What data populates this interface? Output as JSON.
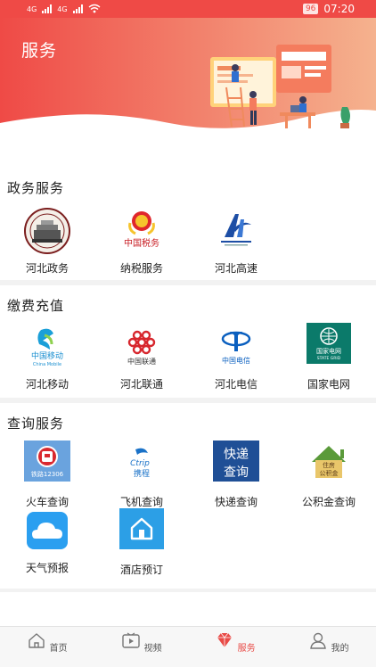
{
  "status_bar": {
    "signal_1": "4G",
    "signal_2": "4G",
    "battery": "96",
    "time": "07:20"
  },
  "header": {
    "title": "服务"
  },
  "sections": [
    {
      "title": "政务服务",
      "items": [
        {
          "label": "河北政务",
          "icon": "hebei-government-emblem-icon"
        },
        {
          "label": "纳税服务",
          "icon": "china-tax-emblem-icon"
        },
        {
          "label": "河北高速",
          "icon": "hebei-expressway-logo-icon"
        }
      ]
    },
    {
      "title": "缴费充值",
      "items": [
        {
          "label": "河北移动",
          "icon": "china-mobile-logo-icon",
          "logo_text": "中国移动",
          "logo_sub": "China Mobile"
        },
        {
          "label": "河北联通",
          "icon": "china-unicom-logo-icon",
          "logo_text": "中国联通"
        },
        {
          "label": "河北电信",
          "icon": "china-telecom-logo-icon",
          "logo_text": "中国电信"
        },
        {
          "label": "国家电网",
          "icon": "state-grid-logo-icon",
          "logo_text": "国家电网",
          "logo_sub": "STATE GRID"
        }
      ]
    },
    {
      "title": "查询服务",
      "items": [
        {
          "label": "火车查询",
          "icon": "railway-12306-icon",
          "logo_text": "铁路12306"
        },
        {
          "label": "飞机查询",
          "icon": "ctrip-logo-icon",
          "logo_text": "携程",
          "logo_sub": "Ctrip"
        },
        {
          "label": "快递查询",
          "icon": "express-query-icon",
          "logo_text_1": "快递",
          "logo_text_2": "查询"
        },
        {
          "label": "公积金查询",
          "icon": "housing-fund-icon",
          "logo_text_1": "住房",
          "logo_text_2": "公积金"
        },
        {
          "label": "天气预报",
          "icon": "weather-cloud-icon"
        },
        {
          "label": "酒店预订",
          "icon": "hotel-house-icon"
        }
      ]
    }
  ],
  "bottom_nav": [
    {
      "label": "首页",
      "icon": "home-icon",
      "active": false
    },
    {
      "label": "视频",
      "icon": "video-icon",
      "active": false
    },
    {
      "label": "服务",
      "icon": "service-diamond-icon",
      "active": true
    },
    {
      "label": "我的",
      "icon": "profile-icon",
      "active": false
    }
  ],
  "colors": {
    "accent": "#e84a46",
    "header_start": "#ef4a46",
    "header_end": "#f5b28e"
  }
}
